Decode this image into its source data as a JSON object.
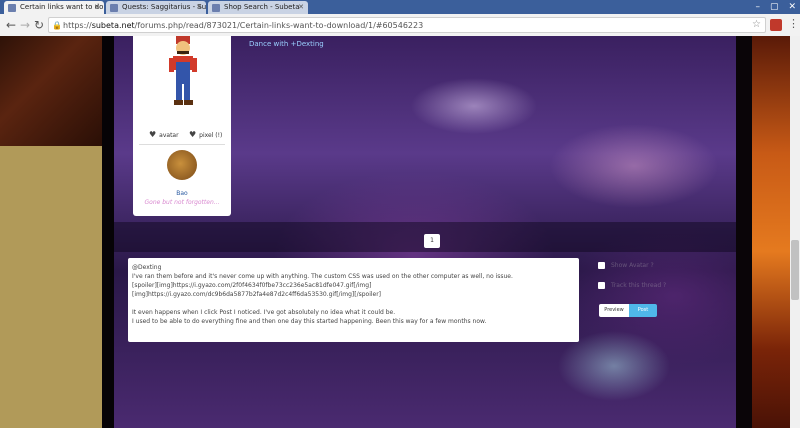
{
  "browser": {
    "tabs": [
      {
        "label": "Certain links want to do",
        "active": true
      },
      {
        "label": "Quests: Saggitarius - Sub",
        "active": false
      },
      {
        "label": "Shop Search - Subeta",
        "active": false
      }
    ],
    "url_prefix": "https://",
    "url_host": "subeta.net",
    "url_path": "/forums.php/read/873021/Certain-links-want-to-download/1/#60546223"
  },
  "post": {
    "dance_link": "Dance with +Dexting",
    "author_actions": [
      {
        "icon": "heart-icon",
        "label": "avatar"
      },
      {
        "icon": "heart-icon",
        "label": "pixel (!)"
      }
    ],
    "pet_name": "Bao",
    "pet_tagline": "Gone but not forgotten..."
  },
  "pagination": {
    "current_page": "1"
  },
  "reply": {
    "lines": [
      "@Dexting",
      "I've ran them before and it's never come up with anything. The custom CSS was used on the other computer as well, no issue.",
      "[spoiler][img]https://i.gyazo.com/2f0f4634f0fbe73cc236e5ac81dfe047.gif[/img]",
      "[img]https://i.gyazo.com/dc9b6da5877b2fa4e87d2c4ff6da53530.gif[/img][/spoiler]",
      "",
      "It even happens when I click Post I noticed. I've got absolutely no idea what it could be.",
      "I used to be able to do everything fine and then one day this started happening. Been this way for a few months now."
    ]
  },
  "options": [
    {
      "label": "Show Avatar ?"
    },
    {
      "label": "Track this thread ?"
    }
  ],
  "buttons": {
    "preview": "Preview",
    "post": "Post"
  },
  "colors": {
    "accent": "#4fb7e9",
    "link": "#2a5aa0"
  }
}
